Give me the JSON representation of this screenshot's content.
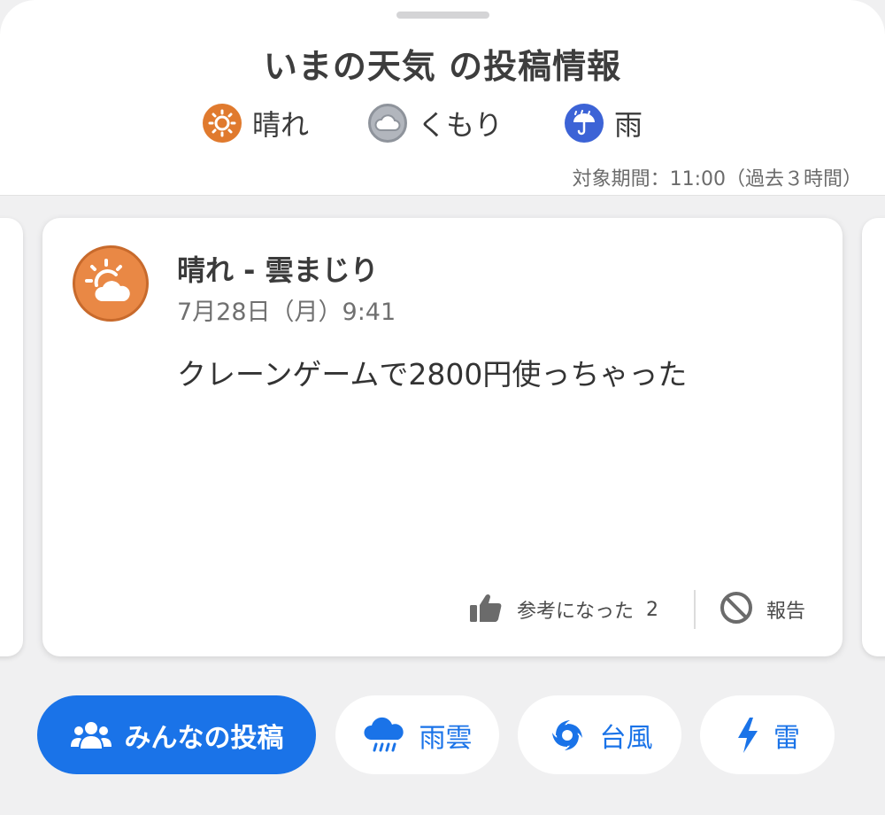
{
  "header": {
    "title": "いまの天気 の投稿情報",
    "legend": [
      {
        "label": "晴れ",
        "icon": "sun-icon",
        "color": "#e07a2e"
      },
      {
        "label": "くもり",
        "icon": "cloud-icon",
        "color": "#a9adb5"
      },
      {
        "label": "雨",
        "icon": "umbrella-icon",
        "color": "#3c63d6"
      }
    ],
    "period": "対象期間：11:00（過去３時間）"
  },
  "post": {
    "weather": "晴れ - 雲まじり",
    "date": "7月28日（月）9:41",
    "body": "クレーンゲームで2800円使っちゃった",
    "helpful_label": "参考になった",
    "helpful_count": "2",
    "report_label": "報告",
    "avatar_icon": "sun-cloud-icon",
    "avatar_color": "#e98845"
  },
  "filters": [
    {
      "label": "みんなの投稿",
      "icon": "people-icon",
      "active": true
    },
    {
      "label": "雨雲",
      "icon": "rain-cloud-icon",
      "active": false
    },
    {
      "label": "台風",
      "icon": "typhoon-icon",
      "active": false
    },
    {
      "label": "雷",
      "icon": "lightning-icon",
      "active": false
    }
  ],
  "colors": {
    "accent": "#1a73e8",
    "background": "#f0f0f1"
  }
}
